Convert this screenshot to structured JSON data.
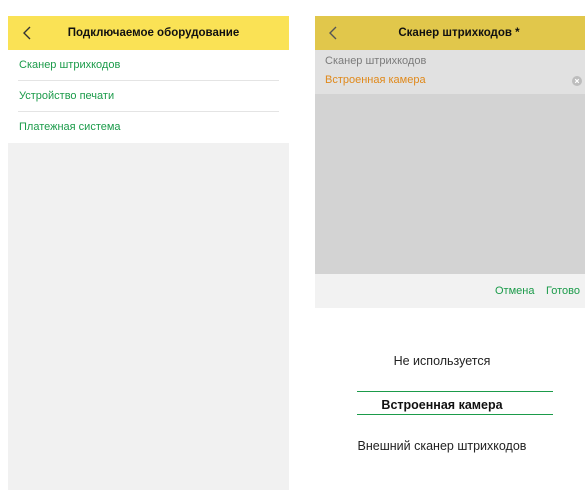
{
  "colors": {
    "header_yellow": "#fae255",
    "header_yellow_dimmed": "#e1c74b",
    "accent_green": "#1b9b4a",
    "value_orange": "#e0891b"
  },
  "left_screen": {
    "header": {
      "back_icon": "chevron-left-icon",
      "title": "Подключаемое оборудование"
    },
    "menu": [
      {
        "label": "Сканер штрихкодов"
      },
      {
        "label": "Устройство печати"
      },
      {
        "label": "Платежная система"
      }
    ]
  },
  "right_screen": {
    "header": {
      "back_icon": "chevron-left-icon",
      "title": "Сканер штрихкодов *"
    },
    "field": {
      "label": "Сканер штрихкодов",
      "value": "Встроенная камера",
      "clear_icon": "clear-circle-icon"
    },
    "actions": {
      "cancel": "Отмена",
      "done": "Готово"
    },
    "picker": {
      "options": [
        "Не используется",
        "Встроенная камера",
        "Внешний сканер штрихкодов"
      ],
      "selected": "Встроенная камера"
    }
  }
}
